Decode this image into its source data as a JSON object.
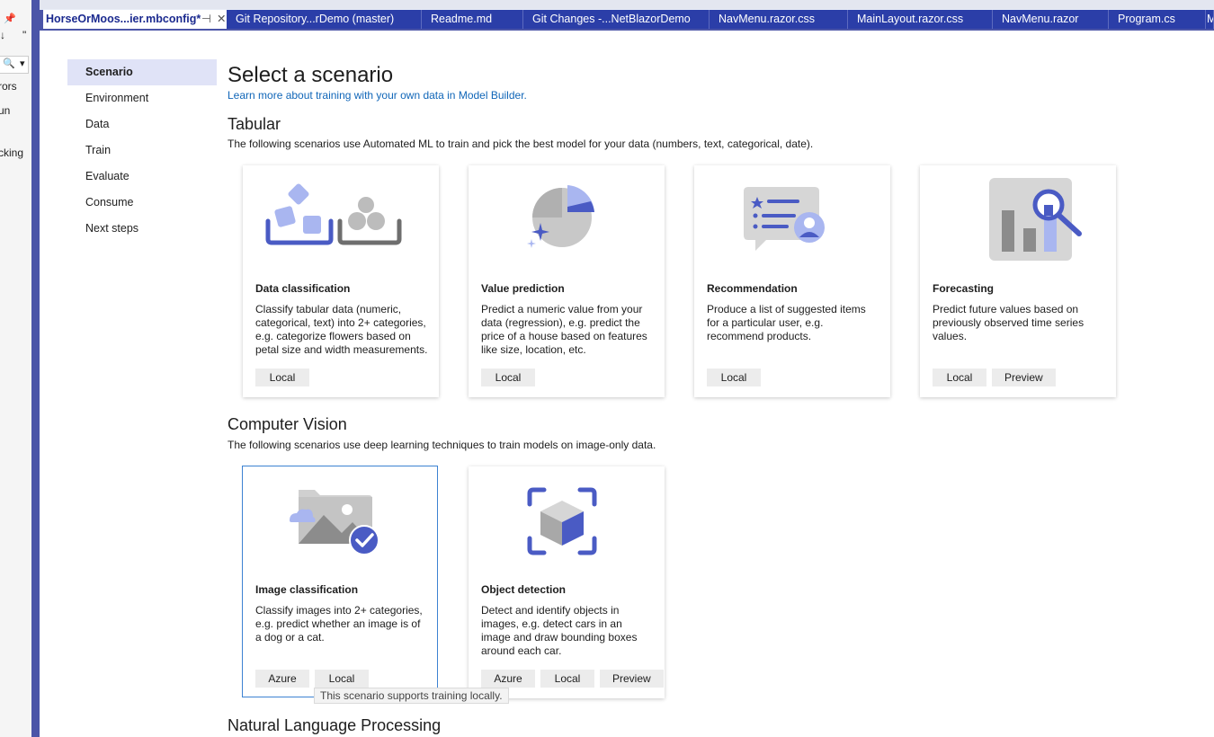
{
  "left_dock": {
    "pin_glyph": "📌",
    "more_glyph": "\"",
    "arrow_glyph": "↓",
    "search_glyph": "🔍",
    "dropdown_glyph": "▾",
    "cut_labels": [
      "rors",
      "un",
      "cking"
    ]
  },
  "tabs": [
    {
      "label": "HorseOrMoos...ier.mbconfig*",
      "active": true
    },
    {
      "label": "Git Repository...rDemo (master)"
    },
    {
      "label": "Readme.md"
    },
    {
      "label": "Git Changes -...NetBlazorDemo"
    },
    {
      "label": "NavMenu.razor.css"
    },
    {
      "label": "MainLayout.razor.css"
    },
    {
      "label": "NavMenu.razor"
    },
    {
      "label": "Program.cs"
    },
    {
      "label": "M"
    }
  ],
  "tab_pin_glyph": "⊣",
  "tab_close_glyph": "✕",
  "nav": {
    "items": [
      "Scenario",
      "Environment",
      "Data",
      "Train",
      "Evaluate",
      "Consume",
      "Next steps"
    ],
    "selected": "Scenario"
  },
  "main": {
    "title": "Select a scenario",
    "learn_link": "Learn more about training with your own data in Model Builder.",
    "sections": [
      {
        "title": "Tabular",
        "desc": "The following scenarios use Automated ML to train and pick the best model for your data (numbers, text, categorical, date).",
        "cards": [
          {
            "icon": "data-classification-icon",
            "title": "Data classification",
            "desc": "Classify tabular data (numeric, categorical, text) into 2+ categories, e.g. categorize flowers based on petal size and width measurements.",
            "tags": [
              "Local"
            ]
          },
          {
            "icon": "value-prediction-icon",
            "title": "Value prediction",
            "desc": "Predict a numeric value from your data (regression), e.g. predict the price of a house based on features like size, location, etc.",
            "tags": [
              "Local"
            ]
          },
          {
            "icon": "recommendation-icon",
            "title": "Recommendation",
            "desc": "Produce a list of suggested items for a particular user, e.g. recommend products.",
            "tags": [
              "Local"
            ]
          },
          {
            "icon": "forecasting-icon",
            "title": "Forecasting",
            "desc": "Predict future values based on previously observed time series values.",
            "tags": [
              "Local",
              "Preview"
            ]
          }
        ]
      },
      {
        "title": "Computer Vision",
        "desc": "The following scenarios use deep learning techniques to train models on image-only data.",
        "cards": [
          {
            "icon": "image-classification-icon",
            "title": "Image classification",
            "desc": "Classify images into 2+ categories, e.g. predict whether an image is of a dog or a cat.",
            "tags": [
              "Azure",
              "Local"
            ],
            "selected": true
          },
          {
            "icon": "object-detection-icon",
            "title": "Object detection",
            "desc": "Detect and identify objects in images, e.g. detect cars in an image and draw bounding boxes around each car.",
            "tags": [
              "Azure",
              "Local",
              "Preview"
            ]
          }
        ]
      },
      {
        "title": "Natural Language Processing"
      }
    ],
    "tooltip": "This scenario supports training locally."
  },
  "colors": {
    "accent": "#4b55a8",
    "tab_inactive": "#2b3ea8",
    "link": "#1066b8",
    "icon_blue": "#4a5bc4",
    "icon_light_blue": "#a9b6f0",
    "icon_gray": "#a8a8a8"
  }
}
